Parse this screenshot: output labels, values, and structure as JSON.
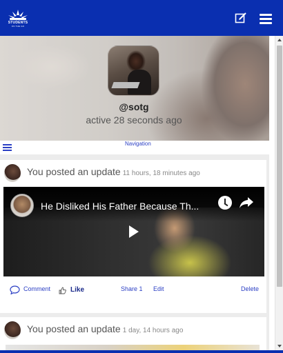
{
  "app": {
    "logo_text": "STUDENTS",
    "logo_subtext": "ON THE GO",
    "icons": {
      "logo": "sun-burst-logo",
      "compose": "compose-icon",
      "menu": "hamburger-menu-icon"
    },
    "colors": {
      "brand": "#0a2fb0",
      "link": "#2b3fc4"
    }
  },
  "profile": {
    "username": "@sotg",
    "status": "active 28 seconds ago"
  },
  "navigation": {
    "label": "Navigation"
  },
  "posts": [
    {
      "author_text": "You posted an update",
      "time": "11 hours, 18 minutes ago",
      "video": {
        "title": "He Disliked His Father Because Th...",
        "icons": [
          "watch-later-icon",
          "share-icon",
          "play-icon"
        ]
      },
      "actions": {
        "comment": "Comment",
        "like": "Like",
        "share": "Share 1",
        "edit": "Edit",
        "delete": "Delete"
      }
    },
    {
      "author_text": "You posted an update",
      "time": "1 day, 14 hours ago"
    }
  ]
}
